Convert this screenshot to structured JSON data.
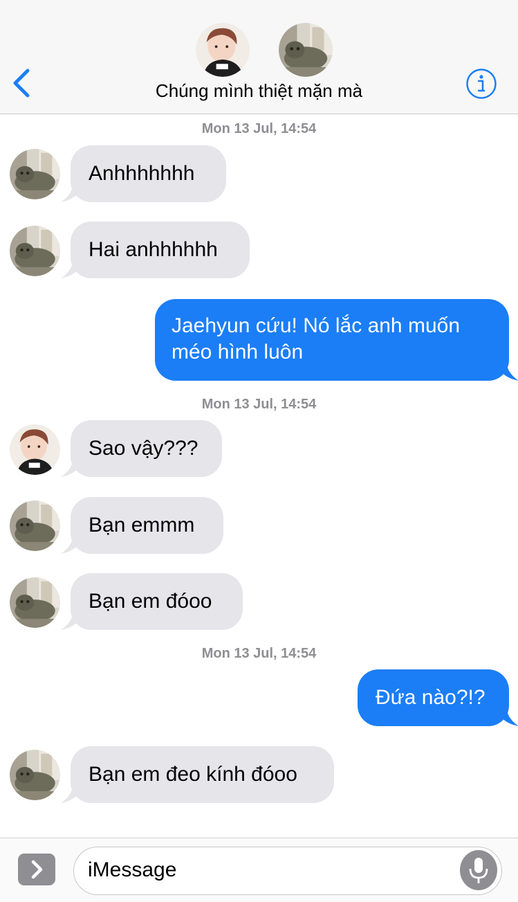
{
  "header": {
    "title": "Chúng mình thiệt mặn mà",
    "back_icon": "chevron-left-icon",
    "info_icon": "info-circle-icon",
    "accent": "#1b7ef6"
  },
  "timestamps": [
    "Mon 13 Jul, 14:54",
    "Mon 13 Jul, 14:54",
    "Mon 13 Jul, 14:54"
  ],
  "messages": [
    {
      "from": "cat",
      "text": "Anhhhhhhh"
    },
    {
      "from": "cat",
      "text": "Hai anhhhhhh"
    },
    {
      "from": "me",
      "text": "Jaehyun cứu! Nó lắc anh muốn méo hình luôn"
    },
    {
      "from": "boy",
      "text": "Sao vậy???"
    },
    {
      "from": "cat",
      "text": "Bạn emmm"
    },
    {
      "from": "cat",
      "text": "Bạn em đóoo"
    },
    {
      "from": "me",
      "text": "Đứa nào?!?"
    },
    {
      "from": "cat",
      "text": "Bạn em đeo kính đóoo"
    }
  ],
  "composer": {
    "placeholder": "iMessage",
    "apps_icon": "chevron-right-icon",
    "mic_icon": "microphone-icon"
  },
  "colors": {
    "incoming_bubble": "#e5e5ea",
    "outgoing_bubble": "#1b7ef6",
    "timestamp": "#8e8e93"
  }
}
